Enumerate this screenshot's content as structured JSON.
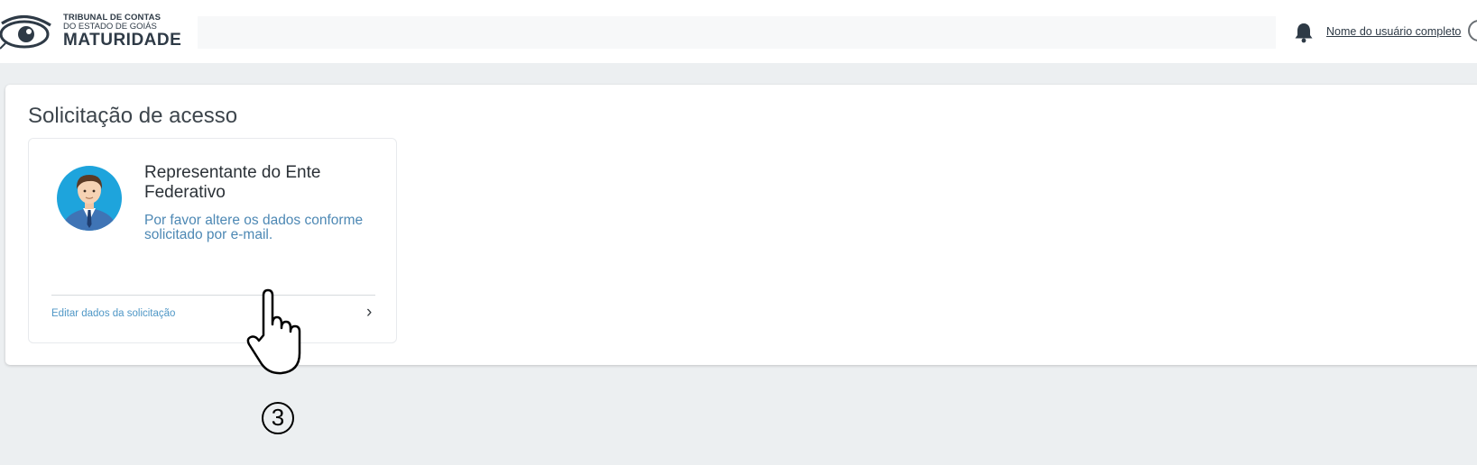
{
  "header": {
    "logo": {
      "line1": "TRIBUNAL DE CONTAS",
      "line2": "DO ESTADO DE GOIÁS",
      "line3": "MATURIDADE"
    },
    "bell_icon": "bell-icon",
    "user_name": "Nome do usuário completo"
  },
  "page": {
    "title": "Solicitação de acesso"
  },
  "card": {
    "avatar_icon": "user-avatar-icon",
    "title": "Representante do Ente Federativo",
    "description": "Por favor altere os dados conforme solicitado por e-mail.",
    "link_label": "Editar dados da solicitação",
    "chevron": "›"
  },
  "annotation": {
    "step_number": "3",
    "pointer_icon": "hand-pointer-icon"
  },
  "colors": {
    "background": "#eceff1",
    "link": "#4f97c6",
    "description": "#4d88b4",
    "avatar_bg": "#1ea4dc"
  }
}
